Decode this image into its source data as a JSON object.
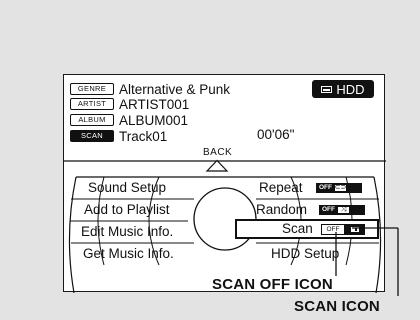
{
  "source": {
    "genre_tag": "GENRE",
    "genre_value": "Alternative & Punk",
    "artist_tag": "ARTIST",
    "artist_value": "ARTIST001",
    "album_tag": "ALBUM",
    "album_value": "ALBUM001",
    "scan_tag": "SCAN",
    "track_value": "Track01",
    "elapsed_time": "00'06\"",
    "media_badge": "HDD",
    "media_icon": "hard-drive-icon"
  },
  "nav": {
    "back_label": "BACK",
    "up_icon": "triangle-up-icon"
  },
  "menu": {
    "left_items": [
      "Sound Setup",
      "Add to Playlist",
      "Edit Music Info.",
      "Get Music Info."
    ],
    "right_items": [
      "Repeat",
      "Random",
      "Scan",
      "HDD Setup"
    ],
    "repeat_status": "OFF",
    "random_status": "OFF",
    "scan_status_off": "OFF",
    "selected_item": "Scan"
  },
  "callouts": {
    "scan_off_icon": "SCAN OFF ICON",
    "scan_icon": "SCAN ICON"
  },
  "colors": {
    "background": "#e3e3e3",
    "screen": "#ffffff",
    "ink": "#111111"
  }
}
